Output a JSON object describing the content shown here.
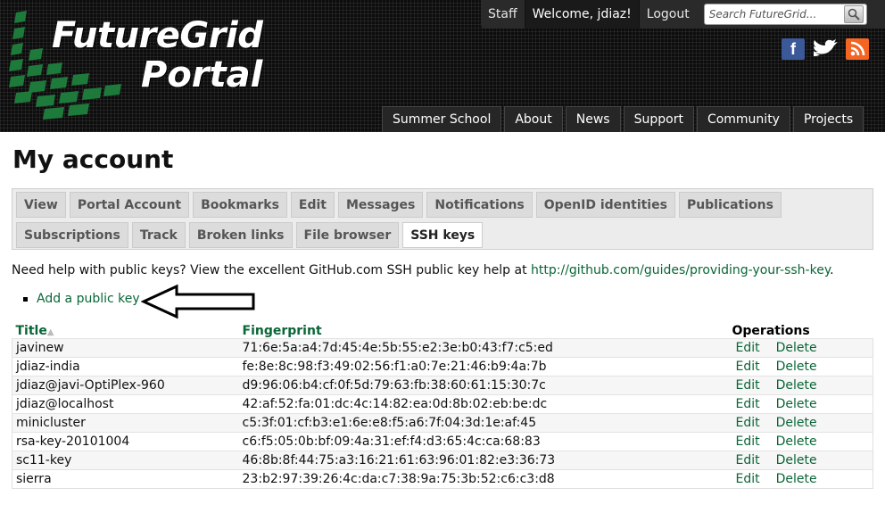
{
  "header": {
    "logo_line1": "FutureGrid",
    "logo_line2": "Portal",
    "topbar": {
      "staff": "Staff",
      "welcome": "Welcome, jdiaz!",
      "logout": "Logout",
      "search_placeholder": "Search FutureGrid..."
    },
    "social": {
      "facebook": "f"
    },
    "nav": [
      "Summer School",
      "About",
      "News",
      "Support",
      "Community",
      "Projects"
    ]
  },
  "page": {
    "title": "My account",
    "tabs_row1": [
      "View",
      "Portal Account",
      "Bookmarks",
      "Edit",
      "Messages",
      "Notifications",
      "OpenID identities",
      "Publications"
    ],
    "tabs_row2": [
      "Subscriptions",
      "Track",
      "Broken links",
      "File browser",
      "SSH keys"
    ],
    "active_tab": "SSH keys",
    "help_text": "Need help with public keys? View the excellent GitHub.com SSH public key help at",
    "help_link": "http://github.com/guides/providing-your-ssh-key",
    "help_end": ".",
    "add_key": "Add a public key"
  },
  "table": {
    "headers": {
      "title": "Title",
      "fingerprint": "Fingerprint",
      "operations": "Operations"
    },
    "edit_label": "Edit",
    "delete_label": "Delete",
    "rows": [
      {
        "title": "javinew",
        "fingerprint": "71:6e:5a:a4:7d:45:4e:5b:55:e2:3e:b0:43:f7:c5:ed"
      },
      {
        "title": "jdiaz-india",
        "fingerprint": "fe:8e:8c:98:f3:49:02:56:f1:a0:7e:21:46:b9:4a:7b"
      },
      {
        "title": "jdiaz@javi-OptiPlex-960",
        "fingerprint": "d9:96:06:b4:cf:0f:5d:79:63:fb:38:60:61:15:30:7c"
      },
      {
        "title": "jdiaz@localhost",
        "fingerprint": "42:af:52:fa:01:dc:4c:14:82:ea:0d:8b:02:eb:be:dc"
      },
      {
        "title": "minicluster",
        "fingerprint": "c5:3f:01:cf:b3:e1:6e:e8:f5:a6:7f:04:3d:1e:af:45"
      },
      {
        "title": "rsa-key-20101004",
        "fingerprint": "c6:f5:05:0b:bf:09:4a:31:ef:f4:d3:65:4c:ca:68:83"
      },
      {
        "title": "sc11-key",
        "fingerprint": "46:8b:8f:44:75:a3:16:21:61:63:96:01:82:e3:36:73"
      },
      {
        "title": "sierra",
        "fingerprint": "23:b2:97:39:26:4c:da:c7:38:9a:75:3b:52:c6:c3:d8"
      }
    ]
  },
  "colors": {
    "link_green": "#0a6637",
    "header_bg": "#0d0d0d",
    "logo_green": "#1f7a3a"
  }
}
